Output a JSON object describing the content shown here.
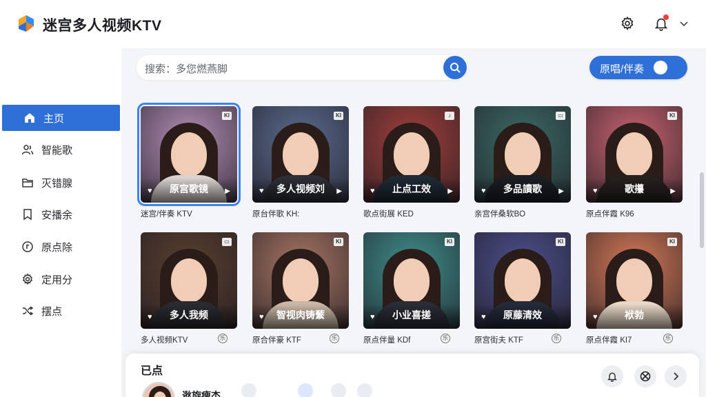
{
  "app": {
    "title": "迷宫多人视频KTV"
  },
  "colors": {
    "accent": "#2f6fd8",
    "selected_outline": "#3b82f6",
    "notification": "#ff3b30"
  },
  "header": {
    "icons": [
      "gear-icon",
      "bell-icon",
      "chevron-down-icon"
    ]
  },
  "sidebar": {
    "items": [
      {
        "label": "主页",
        "icon": "home-icon",
        "active": true
      },
      {
        "label": "智能歌",
        "icon": "users-icon",
        "active": false
      },
      {
        "label": "灭错腺",
        "icon": "folder-icon",
        "active": false
      },
      {
        "label": "安播余",
        "icon": "bookmark-icon",
        "active": false
      },
      {
        "label": "原点除",
        "icon": "disc-icon",
        "active": false
      },
      {
        "label": "定用分",
        "icon": "gear-icon",
        "active": false
      },
      {
        "label": "摆点",
        "icon": "shuffle-icon",
        "active": false
      }
    ]
  },
  "search": {
    "label": "搜索：多您燃燕脚",
    "icon": "search-icon"
  },
  "toggle": {
    "label": "原唱/伴奏",
    "on": true
  },
  "cards": [
    {
      "title": "原宫歌镜",
      "caption": "迷宫/伴奏 KTV",
      "badge": "KI",
      "selected": true,
      "bg": "#b58fb8",
      "cloth": "#d9d2cf"
    },
    {
      "title": "多人视频刘",
      "caption": "原台伴歌 KH:",
      "badge": "KI",
      "selected": false,
      "bg": "#5a6c8f",
      "cloth": "#2d2f38"
    },
    {
      "title": "止点工效",
      "caption": "歌点街展 KED",
      "badge": "♪",
      "selected": false,
      "bg": "#a13f3a",
      "cloth": "#1f2a36"
    },
    {
      "title": "多品讀歌",
      "caption": "亲宫伴桑软BO",
      "badge": "▭",
      "selected": false,
      "bg": "#3b6b66",
      "cloth": "#1b1e24"
    },
    {
      "title": "歌攥",
      "caption": "原点伴霞 K96",
      "badge": "KI",
      "selected": false,
      "bg": "#c9646f",
      "cloth": "#26211f"
    },
    {
      "title": "多人我频",
      "caption": "多人视频KTV",
      "badge": "▭",
      "selected": false,
      "bg": "#5a3f2e",
      "cloth": "#2a2b30"
    },
    {
      "title": "智视肉铸蘩",
      "caption": "原合伴豪 KTF",
      "badge": "KI",
      "selected": false,
      "bg": "#a87662",
      "cloth": "#c9b8a6"
    },
    {
      "title": "小业喜搓",
      "caption": "原点伴量 KDf",
      "badge": "KI",
      "selected": false,
      "bg": "#3f8f8c",
      "cloth": "#2a2d36"
    },
    {
      "title": "原藤清效",
      "caption": "原宫街夫 KTF",
      "badge": "KI",
      "selected": false,
      "bg": "#4c4f8c",
      "cloth": "#252a3a"
    },
    {
      "title": "袱勃",
      "caption": "原点伴霞 KI7",
      "badge": "KI",
      "selected": false,
      "bg": "#d77a57",
      "cloth": "#e8d8c8"
    }
  ],
  "dock": {
    "title": "已点",
    "now_playing": "逖旋痺杰"
  }
}
